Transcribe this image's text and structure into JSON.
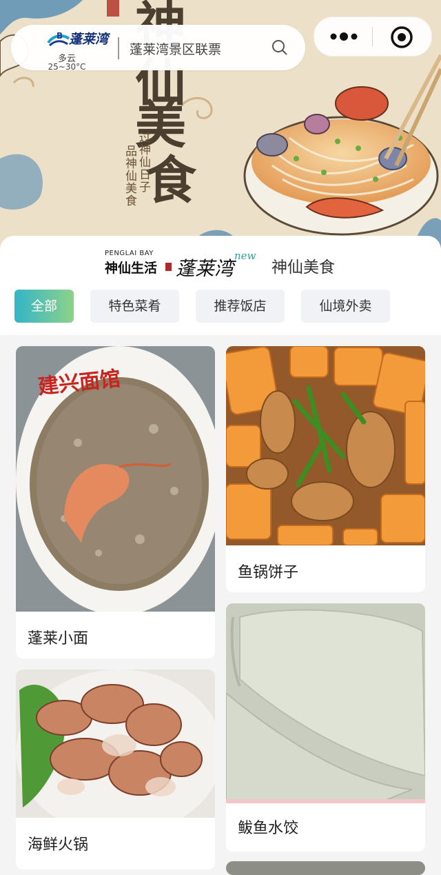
{
  "hero": {
    "title_line1": "神",
    "title_line2": "仙",
    "title_line3": "美",
    "title_line4": "食",
    "subtitle_1": "过神仙日子",
    "subtitle_2": "品神仙美食"
  },
  "topbar": {
    "logo_text": "蓬莱湾",
    "weather": "多云",
    "temperature": "25~30°C",
    "search_text": "蓬莱湾景区联票"
  },
  "header": {
    "brand_en": "PENGLAI BAY",
    "brand_cn": "神仙生活",
    "brand_logo": "蓬莱湾",
    "brand_new": "new",
    "section_title": "神仙美食"
  },
  "tabs": [
    {
      "label": "全部",
      "active": true
    },
    {
      "label": "特色菜肴",
      "active": false
    },
    {
      "label": "推荐饭店",
      "active": false
    },
    {
      "label": "仙境外卖",
      "active": false
    }
  ],
  "cards": [
    {
      "title": "蓬莱小面",
      "photo_text": "建兴面馆"
    },
    {
      "title": "鱼锅饼子"
    },
    {
      "title": "海鲜火锅"
    },
    {
      "title": "鲅鱼水饺"
    }
  ],
  "colors": {
    "accent_gradient_start": "#33b4c6",
    "accent_gradient_end": "#8ed28a",
    "brand_blue": "#16327a",
    "hero_bg": "#ece1c8"
  }
}
